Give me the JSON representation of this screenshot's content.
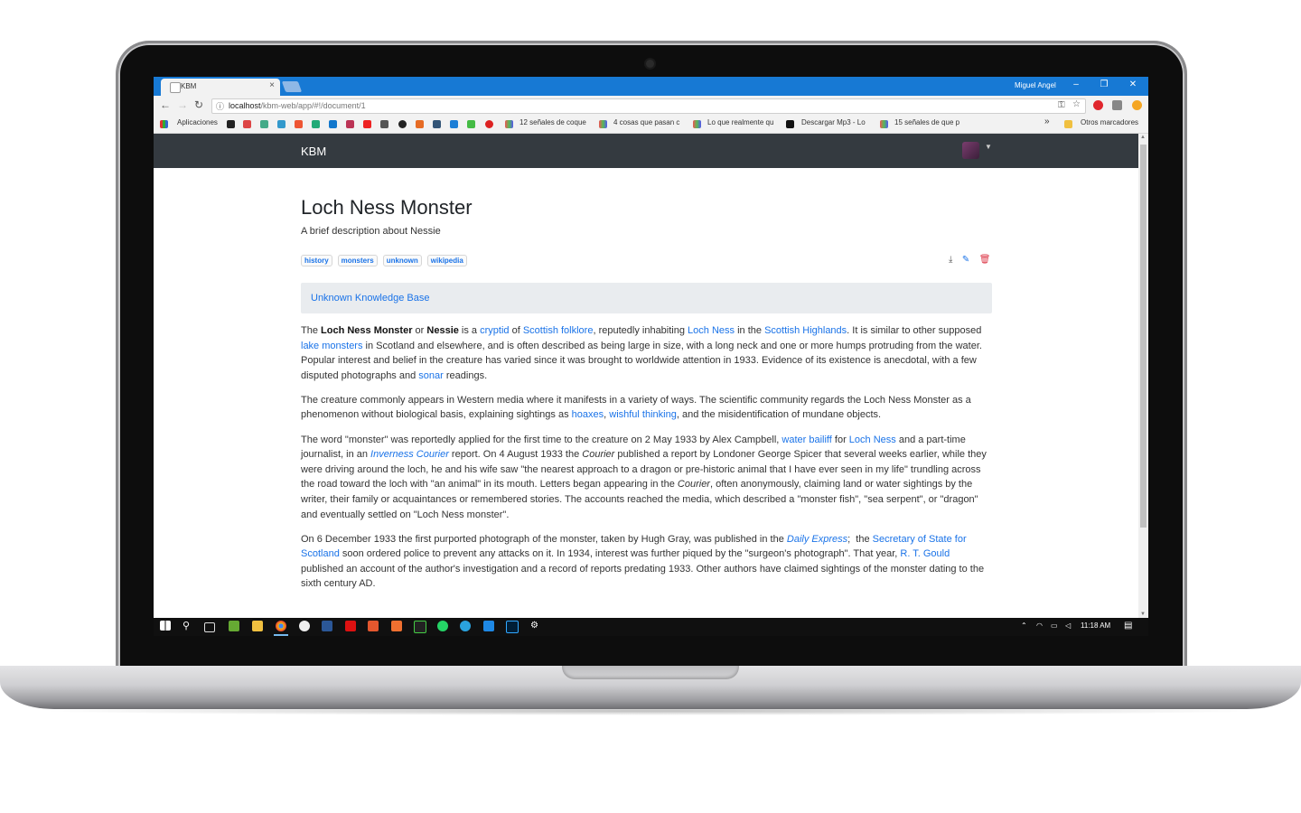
{
  "browser": {
    "tab_title": "KBM",
    "tab_close": "×",
    "user": "Miguel Angel",
    "window_controls": {
      "minimize": "–",
      "restore": "❐",
      "close": "✕"
    },
    "url_host": "localhost",
    "url_path": "/kbm-web/app/#!/document/1",
    "bookmarks": [
      "Aplicaciones",
      "12 señales de coque",
      "4 cosas que pasan c",
      "Lo que realmente qu",
      "Descargar Mp3 - Lo",
      "15 señales de que p"
    ],
    "bookmarks_more": "»",
    "other_bookmarks": "Otros marcadores"
  },
  "app": {
    "brand": "KBM"
  },
  "document": {
    "title": "Loch Ness Monster",
    "subtitle": "A brief description about Nessie",
    "tags": [
      "history",
      "monsters",
      "unknown",
      "wikipedia"
    ],
    "knowledge_base": "Unknown Knowledge Base"
  },
  "article": {
    "p1": {
      "t1": "The ",
      "b1": "Loch Ness Monster",
      "t2": " or ",
      "b2": "Nessie",
      "t3": " is a ",
      "l1": "cryptid",
      "t4": " of ",
      "l2": "Scottish folklore",
      "t5": ", reputedly inhabiting ",
      "l3": "Loch Ness",
      "t6": " in the ",
      "l4": "Scottish Highlands",
      "t7": ". It is similar to other supposed ",
      "l5": "lake monsters",
      "t8": " in Scotland and elsewhere, and is often described as being large in size, with a long neck and one or more humps protruding from the water. Popular interest and belief in the creature has varied since it was brought to worldwide attention in 1933. Evidence of its existence is anecdotal, with a few disputed photographs and ",
      "l6": "sonar",
      "t9": " readings."
    },
    "p2": {
      "t1": "The creature commonly appears in Western media where it manifests in a variety of ways. The scientific community regards the Loch Ness Monster as a phenomenon without biological basis, explaining sightings as ",
      "l1": "hoaxes",
      "t2": ", ",
      "l2": "wishful thinking",
      "t3": ", and the misidentification of mundane objects."
    },
    "p3": {
      "t1": "The word \"monster\" was reportedly applied for the first time to the creature on 2 May 1933 by Alex Campbell, ",
      "l1": "water bailiff",
      "t2": " for ",
      "l2": "Loch Ness",
      "t3": " and a part-time journalist, in an ",
      "l3": "Inverness Courier",
      "t4": " report. On 4 August 1933 the ",
      "i1": "Courier",
      "t5": " published a report by Londoner George Spicer that several weeks earlier, while they were driving around the loch, he and his wife saw \"the nearest approach to a dragon or pre-historic animal that I have ever seen in my life\" trundling across the road toward the loch with \"an animal\" in its mouth. Letters began appearing in the ",
      "i2": "Courier",
      "t6": ", often anonymously, claiming land or water sightings by the writer, their family or acquaintances or remembered stories. The accounts reached the media, which described a \"monster fish\", \"sea serpent\", or \"dragon\" and eventually settled on \"Loch Ness monster\"."
    },
    "p4": {
      "t1": "On 6 December 1933 the first purported photograph of the monster, taken by Hugh Gray, was published in the ",
      "l1": "Daily Express",
      "t2": ";  the ",
      "l2": "Secretary of State for Scotland",
      "t3": " soon ordered police to prevent any attacks on it. In 1934, interest was further piqued by the \"surgeon's photograph\". That year, ",
      "l3": "R. T. Gould",
      "t4": " published an account of the author's investigation and a record of reports predating 1933. Other authors have claimed sightings of the monster dating to the sixth century AD."
    }
  },
  "taskbar": {
    "clock": "11:18 AM"
  },
  "colors": {
    "titlebar": "#1779d4",
    "navbar": "#343a40",
    "link": "#1a73e8",
    "delete": "#dc3545"
  }
}
